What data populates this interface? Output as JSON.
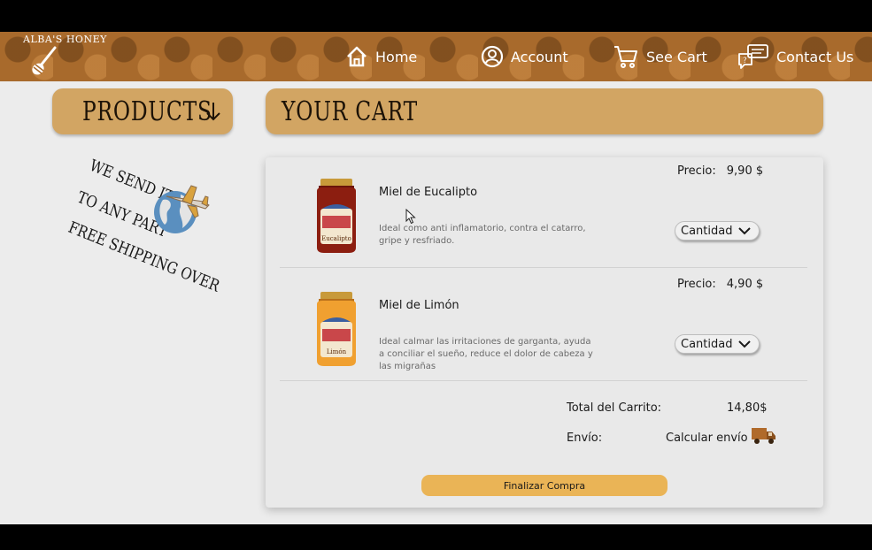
{
  "brand": {
    "logo_text": "ALBA'S HONEY"
  },
  "nav": [
    {
      "label": "Home",
      "icon": "home-icon"
    },
    {
      "label": "Account",
      "icon": "account-icon"
    },
    {
      "label": "See Cart",
      "icon": "cart-icon"
    },
    {
      "label": "Contact Us",
      "icon": "contact-icon"
    }
  ],
  "sidebar": {
    "products_title": "PRODUCTS",
    "promo_lines": [
      "WE SEND IT",
      "TO ANY PART",
      "FREE SHIPPING OVER"
    ]
  },
  "cart": {
    "title": "YOUR CART",
    "items": [
      {
        "name": "Miel de Eucalipto",
        "description": "Ideal como anti inflamatorio, contra el catarro, gripe y resfriado.",
        "price_label": "Precio:",
        "price": "9,90 $",
        "quantity_label": "Cantidad",
        "jar_label": "Eucalipto",
        "jar_color": "#8c1e10"
      },
      {
        "name": "Miel de Limón",
        "description": "Ideal calmar las irritaciones de garganta, ayuda a conciliar el sueño, reduce el dolor de cabeza y las migrañas",
        "price_label": "Precio:",
        "price": "4,90 $",
        "quantity_label": "Cantidad",
        "jar_label": "Limón",
        "jar_color": "#f0a030"
      }
    ],
    "total_label": "Total del Carrito:",
    "total_value": "14,80$",
    "shipping_label": "Envío:",
    "shipping_link": "Calcular envío",
    "checkout_label": "Finalizar Compra"
  },
  "colors": {
    "header_brown": "#a86a2c",
    "pill_tan": "#d2a563",
    "checkout_yellow": "#eab456",
    "background": "#ececec"
  }
}
